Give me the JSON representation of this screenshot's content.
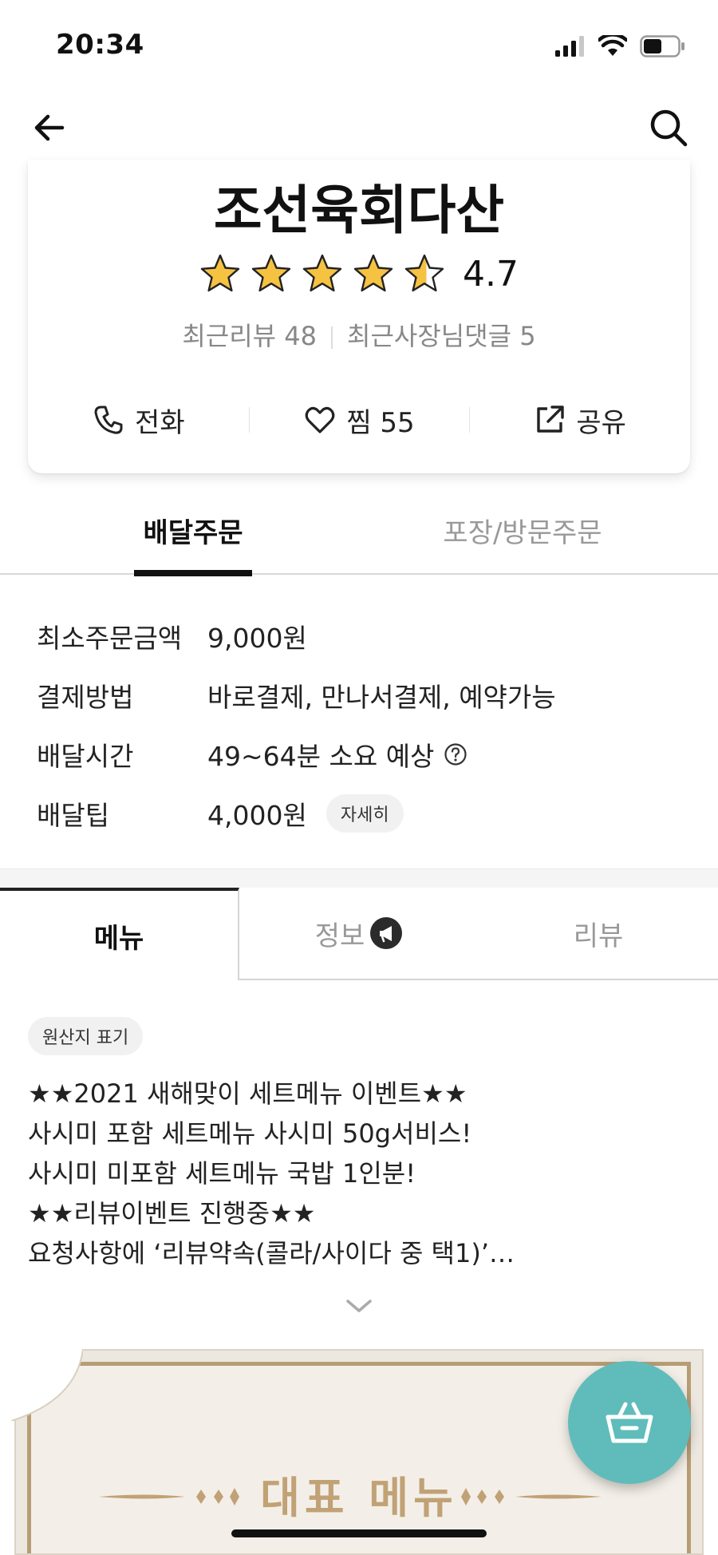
{
  "status_bar": {
    "time": "20:34"
  },
  "store": {
    "name": "조선육회다산",
    "rating": 4.7,
    "rating_text": "4.7",
    "stars_total": 5,
    "recent_reviews": "최근리뷰 48",
    "owner_comments": "최근사장님댓글 5"
  },
  "actions": {
    "call": "전화",
    "like": "찜 55",
    "share": "공유"
  },
  "order_tabs": {
    "delivery": "배달주문",
    "pickup": "포장/방문주문",
    "selected": "delivery"
  },
  "info": {
    "min_order_label": "최소주문금액",
    "min_order_value": "9,000원",
    "payment_label": "결제방법",
    "payment_value": "바로결제, 만나서결제, 예약가능",
    "delivery_time_label": "배달시간",
    "delivery_time_value": "49~64분 소요 예상",
    "tip_label": "배달팁",
    "tip_value": "4,000원",
    "tip_detail": "자세히"
  },
  "content_tabs": {
    "menu": "메뉴",
    "info": "정보",
    "review": "리뷰",
    "selected": "menu"
  },
  "notice": {
    "origin_chip": "원산지 표기",
    "lines": [
      "★★2021 새해맞이 세트메뉴 이벤트★★",
      "사시미 포함 세트메뉴 사시미 50g서비스!",
      "사시미 미포함 세트메뉴 국밥 1인분!",
      "★★리뷰이벤트 진행중★★",
      "요청사항에 ‘리뷰약속(콜라/사이다 중 택1)’…"
    ]
  },
  "banner": {
    "title": "대표 메뉴"
  },
  "colors": {
    "star": "#f5c242",
    "accent_teal": "#5fbcbb",
    "banner_gold": "#c1a276"
  }
}
